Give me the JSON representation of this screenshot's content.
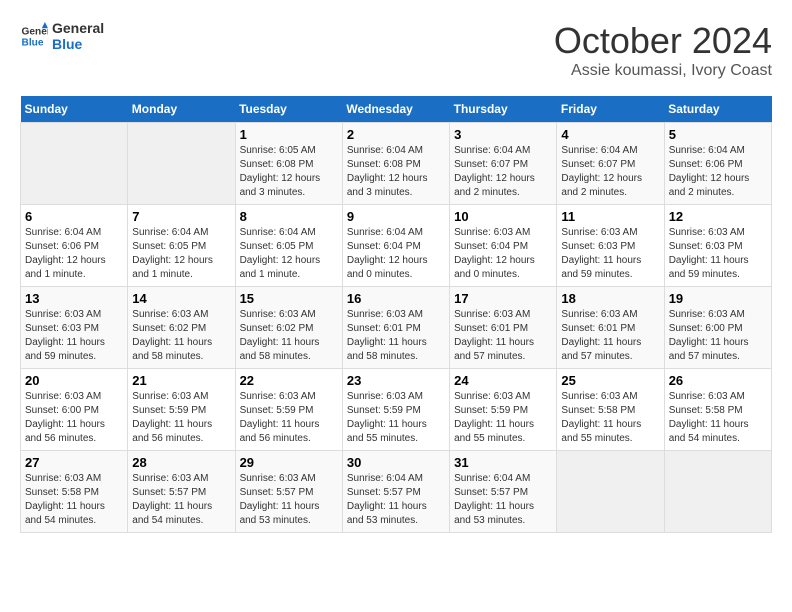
{
  "logo": {
    "line1": "General",
    "line2": "Blue"
  },
  "title": "October 2024",
  "location": "Assie koumassi, Ivory Coast",
  "weekdays": [
    "Sunday",
    "Monday",
    "Tuesday",
    "Wednesday",
    "Thursday",
    "Friday",
    "Saturday"
  ],
  "weeks": [
    [
      {
        "day": "",
        "info": ""
      },
      {
        "day": "",
        "info": ""
      },
      {
        "day": "1",
        "info": "Sunrise: 6:05 AM\nSunset: 6:08 PM\nDaylight: 12 hours\nand 3 minutes."
      },
      {
        "day": "2",
        "info": "Sunrise: 6:04 AM\nSunset: 6:08 PM\nDaylight: 12 hours\nand 3 minutes."
      },
      {
        "day": "3",
        "info": "Sunrise: 6:04 AM\nSunset: 6:07 PM\nDaylight: 12 hours\nand 2 minutes."
      },
      {
        "day": "4",
        "info": "Sunrise: 6:04 AM\nSunset: 6:07 PM\nDaylight: 12 hours\nand 2 minutes."
      },
      {
        "day": "5",
        "info": "Sunrise: 6:04 AM\nSunset: 6:06 PM\nDaylight: 12 hours\nand 2 minutes."
      }
    ],
    [
      {
        "day": "6",
        "info": "Sunrise: 6:04 AM\nSunset: 6:06 PM\nDaylight: 12 hours\nand 1 minute."
      },
      {
        "day": "7",
        "info": "Sunrise: 6:04 AM\nSunset: 6:05 PM\nDaylight: 12 hours\nand 1 minute."
      },
      {
        "day": "8",
        "info": "Sunrise: 6:04 AM\nSunset: 6:05 PM\nDaylight: 12 hours\nand 1 minute."
      },
      {
        "day": "9",
        "info": "Sunrise: 6:04 AM\nSunset: 6:04 PM\nDaylight: 12 hours\nand 0 minutes."
      },
      {
        "day": "10",
        "info": "Sunrise: 6:03 AM\nSunset: 6:04 PM\nDaylight: 12 hours\nand 0 minutes."
      },
      {
        "day": "11",
        "info": "Sunrise: 6:03 AM\nSunset: 6:03 PM\nDaylight: 11 hours\nand 59 minutes."
      },
      {
        "day": "12",
        "info": "Sunrise: 6:03 AM\nSunset: 6:03 PM\nDaylight: 11 hours\nand 59 minutes."
      }
    ],
    [
      {
        "day": "13",
        "info": "Sunrise: 6:03 AM\nSunset: 6:03 PM\nDaylight: 11 hours\nand 59 minutes."
      },
      {
        "day": "14",
        "info": "Sunrise: 6:03 AM\nSunset: 6:02 PM\nDaylight: 11 hours\nand 58 minutes."
      },
      {
        "day": "15",
        "info": "Sunrise: 6:03 AM\nSunset: 6:02 PM\nDaylight: 11 hours\nand 58 minutes."
      },
      {
        "day": "16",
        "info": "Sunrise: 6:03 AM\nSunset: 6:01 PM\nDaylight: 11 hours\nand 58 minutes."
      },
      {
        "day": "17",
        "info": "Sunrise: 6:03 AM\nSunset: 6:01 PM\nDaylight: 11 hours\nand 57 minutes."
      },
      {
        "day": "18",
        "info": "Sunrise: 6:03 AM\nSunset: 6:01 PM\nDaylight: 11 hours\nand 57 minutes."
      },
      {
        "day": "19",
        "info": "Sunrise: 6:03 AM\nSunset: 6:00 PM\nDaylight: 11 hours\nand 57 minutes."
      }
    ],
    [
      {
        "day": "20",
        "info": "Sunrise: 6:03 AM\nSunset: 6:00 PM\nDaylight: 11 hours\nand 56 minutes."
      },
      {
        "day": "21",
        "info": "Sunrise: 6:03 AM\nSunset: 5:59 PM\nDaylight: 11 hours\nand 56 minutes."
      },
      {
        "day": "22",
        "info": "Sunrise: 6:03 AM\nSunset: 5:59 PM\nDaylight: 11 hours\nand 56 minutes."
      },
      {
        "day": "23",
        "info": "Sunrise: 6:03 AM\nSunset: 5:59 PM\nDaylight: 11 hours\nand 55 minutes."
      },
      {
        "day": "24",
        "info": "Sunrise: 6:03 AM\nSunset: 5:59 PM\nDaylight: 11 hours\nand 55 minutes."
      },
      {
        "day": "25",
        "info": "Sunrise: 6:03 AM\nSunset: 5:58 PM\nDaylight: 11 hours\nand 55 minutes."
      },
      {
        "day": "26",
        "info": "Sunrise: 6:03 AM\nSunset: 5:58 PM\nDaylight: 11 hours\nand 54 minutes."
      }
    ],
    [
      {
        "day": "27",
        "info": "Sunrise: 6:03 AM\nSunset: 5:58 PM\nDaylight: 11 hours\nand 54 minutes."
      },
      {
        "day": "28",
        "info": "Sunrise: 6:03 AM\nSunset: 5:57 PM\nDaylight: 11 hours\nand 54 minutes."
      },
      {
        "day": "29",
        "info": "Sunrise: 6:03 AM\nSunset: 5:57 PM\nDaylight: 11 hours\nand 53 minutes."
      },
      {
        "day": "30",
        "info": "Sunrise: 6:04 AM\nSunset: 5:57 PM\nDaylight: 11 hours\nand 53 minutes."
      },
      {
        "day": "31",
        "info": "Sunrise: 6:04 AM\nSunset: 5:57 PM\nDaylight: 11 hours\nand 53 minutes."
      },
      {
        "day": "",
        "info": ""
      },
      {
        "day": "",
        "info": ""
      }
    ]
  ]
}
